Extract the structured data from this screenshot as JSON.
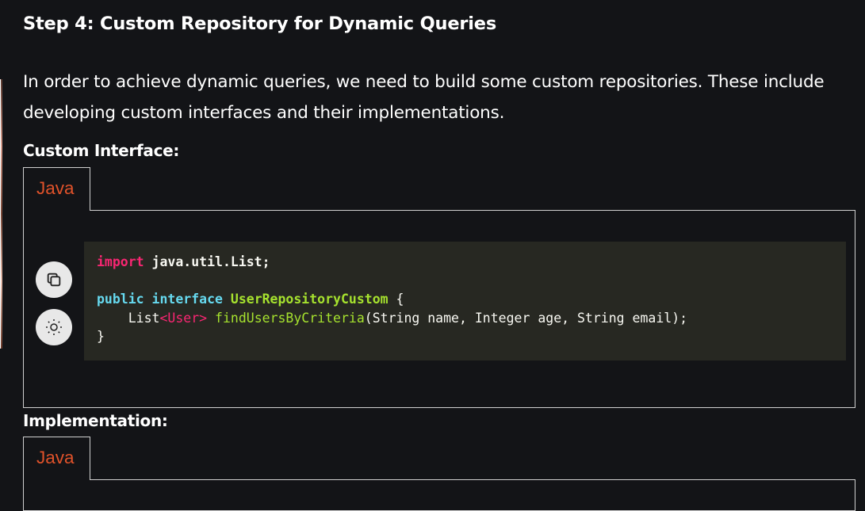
{
  "article": {
    "step_title": "Step 4: Custom Repository for Dynamic Queries",
    "intro": "In order to achieve dynamic queries, we need to build some custom repositories. These include developing custom interfaces and their implementations.",
    "custom_interface_heading": "Custom Interface:",
    "implementation_heading": "Implementation:"
  },
  "code_tabs": {
    "first_label": "Java",
    "second_label": "Java"
  },
  "code": {
    "line1": {
      "kw": "import",
      "rest": "java.util.List;"
    },
    "line3": {
      "kw1": "public",
      "kw2": "interface",
      "name": "UserRepositoryCustom",
      "brace": "{"
    },
    "line4": {
      "indent_type": "    List",
      "generic": "<User>",
      "method": "findUsersByCriteria",
      "args": "(String name, Integer age, String email);"
    },
    "line5": "}"
  },
  "icons": {
    "copy": "copy-icon",
    "theme": "sun-icon"
  },
  "colors": {
    "background": "#131417",
    "tab_text": "#e0522a",
    "code_bg": "#272822",
    "keyword_pink": "#f92672",
    "keyword_blue": "#66d9ef",
    "identifier_green": "#a6e22e"
  }
}
